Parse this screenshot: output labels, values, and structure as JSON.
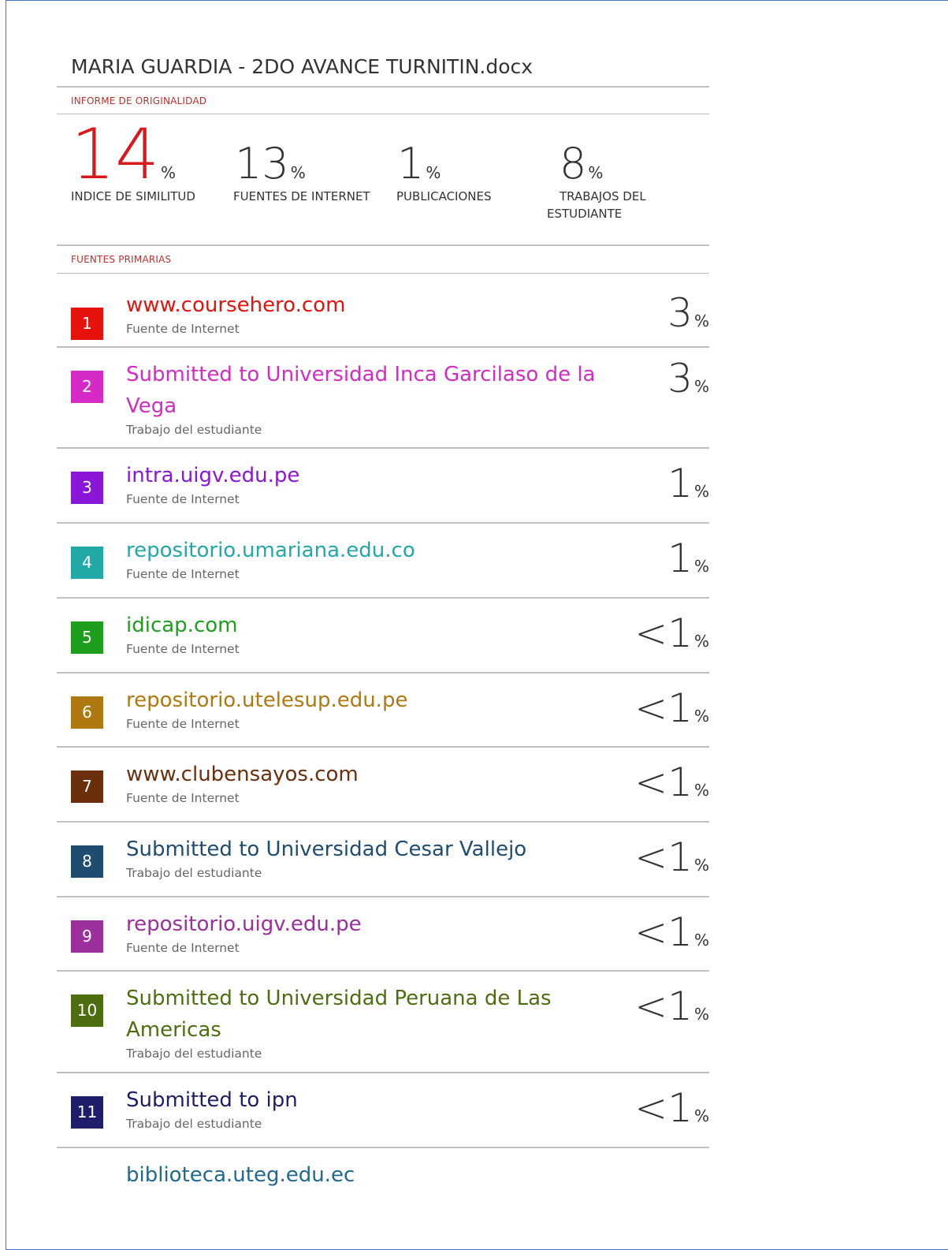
{
  "document": {
    "title": "MARIA GUARDIA - 2DO AVANCE TURNITIN.docx",
    "originality_label": "INFORME DE ORIGINALIDAD",
    "primary_sources_label": "FUENTES PRIMARIAS"
  },
  "summary": [
    {
      "value": "14",
      "unit": "%",
      "label": "INDICE DE SIMILITUD"
    },
    {
      "value": "13",
      "unit": "%",
      "label": "FUENTES DE INTERNET"
    },
    {
      "value": "1",
      "unit": "%",
      "label": "PUBLICACIONES"
    },
    {
      "value": "8",
      "unit": "%",
      "label_line1": "TRABAJOS DEL",
      "label_line2": "ESTUDIANTE"
    }
  ],
  "sources": [
    {
      "rank": "1",
      "name": "www.coursehero.com",
      "type": "Fuente de Internet",
      "prefix": "",
      "percent": "3",
      "unit": "%",
      "color": "#e8120c"
    },
    {
      "rank": "2",
      "name_line1": "Submitted to Universidad Inca Garcilaso de la",
      "name_line2": "Vega",
      "type": "Trabajo del estudiante",
      "prefix": "",
      "percent": "3",
      "unit": "%",
      "color": "#d62ac7"
    },
    {
      "rank": "3",
      "name": "intra.uigv.edu.pe",
      "type": "Fuente de Internet",
      "prefix": "",
      "percent": "1",
      "unit": "%",
      "color": "#8a17d8"
    },
    {
      "rank": "4",
      "name": "repositorio.umariana.edu.co",
      "type": "Fuente de Internet",
      "prefix": "",
      "percent": "1",
      "unit": "%",
      "color": "#23a8a8"
    },
    {
      "rank": "5",
      "name": "idicap.com",
      "type": "Fuente de Internet",
      "prefix": "<",
      "percent": "1",
      "unit": "%",
      "color": "#1d9e1d"
    },
    {
      "rank": "6",
      "name": "repositorio.utelesup.edu.pe",
      "type": "Fuente de Internet",
      "prefix": "<",
      "percent": "1",
      "unit": "%",
      "color": "#b07811"
    },
    {
      "rank": "7",
      "name": "www.clubensayos.com",
      "type": "Fuente de Internet",
      "prefix": "<",
      "percent": "1",
      "unit": "%",
      "color": "#6b2f0e"
    },
    {
      "rank": "8",
      "name": "Submitted to Universidad Cesar Vallejo",
      "type": "Trabajo del estudiante",
      "prefix": "<",
      "percent": "1",
      "unit": "%",
      "color": "#1f4c70"
    },
    {
      "rank": "9",
      "name": "repositorio.uigv.edu.pe",
      "type": "Fuente de Internet",
      "prefix": "<",
      "percent": "1",
      "unit": "%",
      "color": "#9b2f9b"
    },
    {
      "rank": "10",
      "name_line1": "Submitted to Universidad Peruana de Las",
      "name_line2": "Americas",
      "type": "Trabajo del estudiante",
      "prefix": "<",
      "percent": "1",
      "unit": "%",
      "color": "#4d6e10"
    },
    {
      "rank": "11",
      "name": "Submitted to ipn",
      "type": "Trabajo del estudiante",
      "prefix": "<",
      "percent": "1",
      "unit": "%",
      "color": "#1e1e6b"
    }
  ],
  "partial_source": {
    "name": "biblioteca.uteg.edu.ec",
    "color": "#1f6a8c"
  }
}
